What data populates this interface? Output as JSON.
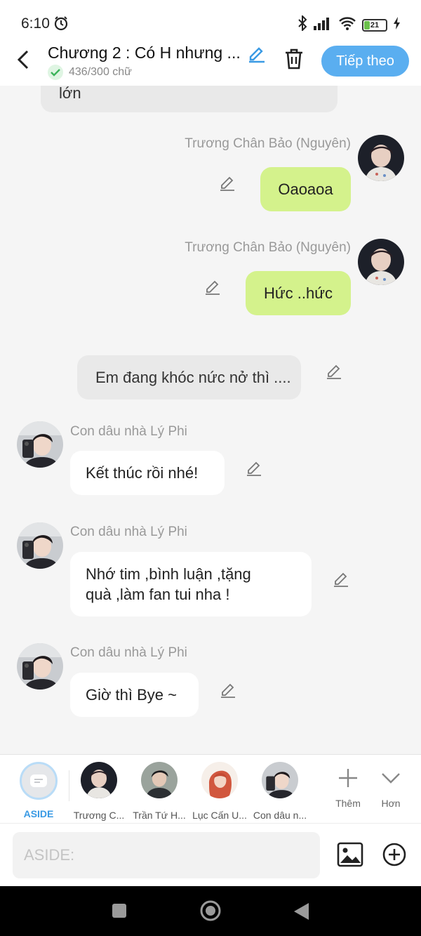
{
  "status": {
    "time": "6:10",
    "battery": "21"
  },
  "header": {
    "title": "Chương 2 : Có H nhưng ...",
    "word_count": "436/300 chữ",
    "next_label": "Tiếp theo"
  },
  "messages": {
    "m0": {
      "text": "lớn"
    },
    "m1": {
      "sender": "Trương Chân Bảo (Nguyên)",
      "text": "Oaoaoa"
    },
    "m2": {
      "sender": "Trương Chân Bảo (Nguyên)",
      "text": "Hức ..hức"
    },
    "m3": {
      "text": "Em đang khóc nức nở thì ...."
    },
    "m4": {
      "sender": "Con dâu nhà Lý Phi",
      "text": "Kết thúc rồi nhé!"
    },
    "m5": {
      "sender": "Con dâu nhà Lý Phi",
      "line1": "Nhớ tim ,bình luận ,tặng",
      "line2": "quà ,làm fan tui nha !"
    },
    "m6": {
      "sender": "Con dâu nhà Lý Phi",
      "text": "Giờ thì Bye ~"
    }
  },
  "characters": [
    {
      "label": "ASIDE"
    },
    {
      "label": "Trương C..."
    },
    {
      "label": "Trần Tứ H..."
    },
    {
      "label": "Lục Cấn U..."
    },
    {
      "label": "Con dâu n..."
    }
  ],
  "tools": {
    "add_label": "Thêm",
    "more_label": "Hơn"
  },
  "composer": {
    "placeholder": "ASIDE:"
  },
  "colors": {
    "accent": "#5aaef0",
    "self_bubble": "#d4f28c",
    "narration_bubble": "#e9e9e9",
    "other_bubble": "#ffffff"
  }
}
